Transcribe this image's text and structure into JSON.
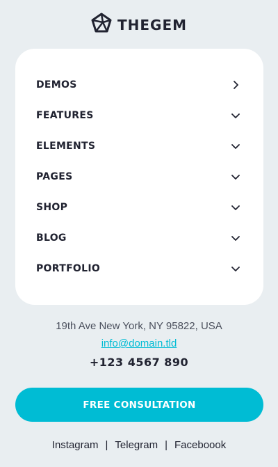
{
  "brand": {
    "name": "THEGEM",
    "logo_icon": "pentagon-gem-icon"
  },
  "menu": {
    "items": [
      {
        "label": "DEMOS",
        "icon": "chevron-right-icon"
      },
      {
        "label": "FEATURES",
        "icon": "chevron-down-icon"
      },
      {
        "label": "ELEMENTS",
        "icon": "chevron-down-icon"
      },
      {
        "label": "PAGES",
        "icon": "chevron-down-icon"
      },
      {
        "label": "SHOP",
        "icon": "chevron-down-icon"
      },
      {
        "label": "BLOG",
        "icon": "chevron-down-icon"
      },
      {
        "label": "PORTFOLIO",
        "icon": "chevron-down-icon"
      }
    ]
  },
  "contact": {
    "address": "19th Ave New York, NY 95822, USA",
    "email": "info@domain.tld",
    "phone": "+123 4567 890"
  },
  "cta": {
    "label": "FREE CONSULTATION"
  },
  "social": {
    "instagram": "Instagram",
    "telegram": "Telegram",
    "facebook": "Faceboook",
    "separator": "|"
  },
  "colors": {
    "accent": "#00bcd4",
    "background": "#e9eef1",
    "card": "#ffffff",
    "text_dark": "#212331"
  }
}
